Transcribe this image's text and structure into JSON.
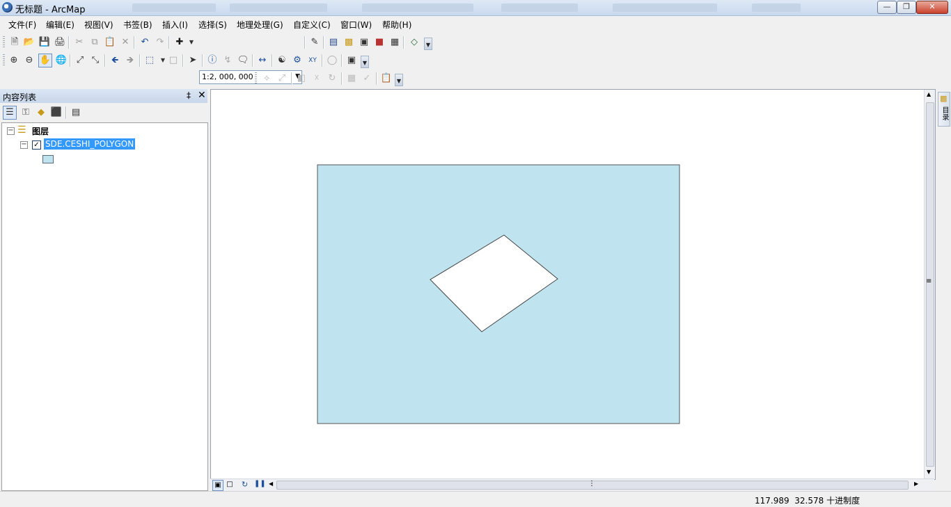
{
  "window": {
    "title": "无标题 - ArcMap"
  },
  "menu": [
    "文件(F)",
    "编辑(E)",
    "视图(V)",
    "书签(B)",
    "插入(I)",
    "选择(S)",
    "地理处理(G)",
    "自定义(C)",
    "窗口(W)",
    "帮助(H)"
  ],
  "toolbar": {
    "scale_value": "1:2, 000, 000"
  },
  "toc": {
    "title": "内容列表",
    "root_label": "图层",
    "layer_name": "SDE.CESHI_POLYGON",
    "layer_checked": true
  },
  "map": {
    "extent_fill": "#bfe4f0",
    "hole_fill": "#ffffff"
  },
  "right_panel": {
    "label": "目录"
  },
  "status": {
    "x": "117.989",
    "y": "32.578",
    "units": "十进制度"
  },
  "colors": {
    "selection_highlight": "#3399ff"
  }
}
